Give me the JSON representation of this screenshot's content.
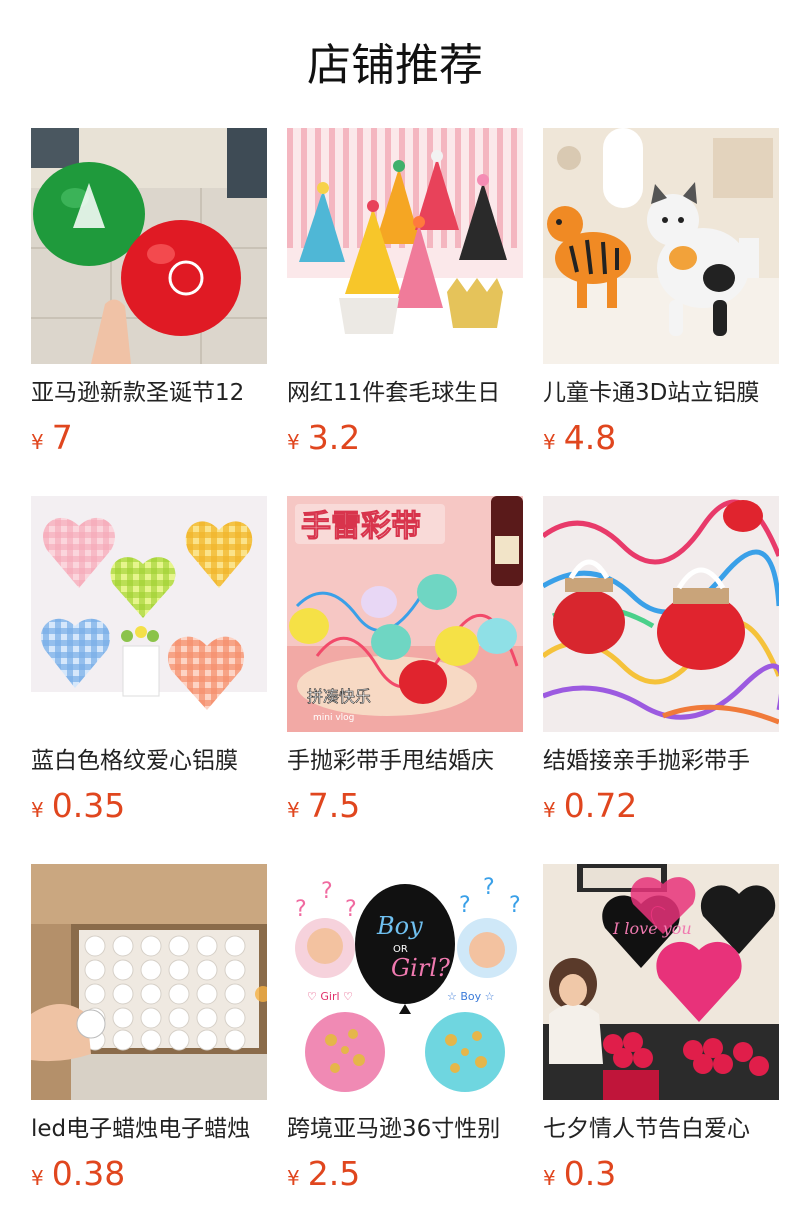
{
  "section_title": "店铺推荐",
  "currency_symbol": "¥",
  "price_color": "#e0461e",
  "products": [
    {
      "name": "亚马逊新款圣诞节12",
      "price": "7",
      "image": "red-green-christmas-balloons"
    },
    {
      "name": "网红11件套毛球生日",
      "price": "3.2",
      "image": "party-hats-set"
    },
    {
      "name": "儿童卡通3D站立铝膜",
      "price": "4.8",
      "image": "standing-tiger-cat-balloons"
    },
    {
      "name": "蓝白色格纹爱心铝膜",
      "price": "0.35",
      "image": "gingham-heart-balloons"
    },
    {
      "name": "手抛彩带手甩结婚庆",
      "price": "7.5",
      "image": "hand-throw-streamers"
    },
    {
      "name": "结婚接亲手抛彩带手",
      "price": "0.72",
      "image": "wedding-streamers"
    },
    {
      "name": "led电子蜡烛电子蜡烛",
      "price": "0.38",
      "image": "led-tea-lights-box"
    },
    {
      "name": "跨境亚马逊36寸性别",
      "price": "2.5",
      "image": "gender-reveal-balloon"
    },
    {
      "name": "七夕情人节告白爱心",
      "price": "0.3",
      "image": "valentine-heart-balloons"
    }
  ],
  "image_text": {
    "streamers_banner": "手雷彩带",
    "streamers_caption": "拼凑快乐",
    "streamers_small": "mini vlog",
    "boy": "Boy",
    "or": "OR",
    "girl": "Girl?",
    "girl_label": "♡ Girl ♡",
    "boy_label": "☆ Boy ☆",
    "love_you": "I love you"
  }
}
